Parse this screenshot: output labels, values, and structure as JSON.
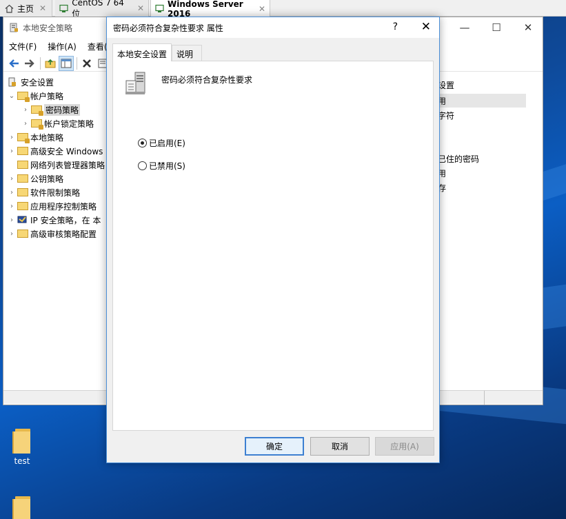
{
  "vm_tabs": [
    {
      "label": "主页",
      "icon": "home-icon"
    },
    {
      "label": "CentOS 7 64 位",
      "icon": "vm-icon"
    },
    {
      "label": "Windows Server 2016",
      "icon": "vm-icon",
      "active": true
    }
  ],
  "mmc": {
    "title": "本地安全策略",
    "menu": [
      "文件(F)",
      "操作(A)",
      "查看(V)"
    ],
    "tree": [
      {
        "label": "安全设置",
        "level": 0
      },
      {
        "label": "帐户策略",
        "level": 1
      },
      {
        "label": "密码策略",
        "level": 2,
        "selected": true
      },
      {
        "label": "帐户锁定策略",
        "level": 2
      },
      {
        "label": "本地策略",
        "level": 1
      },
      {
        "label": "高级安全 Windows",
        "level": 1
      },
      {
        "label": "网络列表管理器策略",
        "level": 1
      },
      {
        "label": "公钥策略",
        "level": 1
      },
      {
        "label": "软件限制策略",
        "level": 1
      },
      {
        "label": "应用程序控制策略",
        "level": 1
      },
      {
        "label": "IP 安全策略，在 本",
        "level": 1
      },
      {
        "label": "高级审核策略配置",
        "level": 1
      }
    ],
    "right_items": [
      "设置",
      "用",
      "字符",
      "已住的密码",
      "用",
      "存"
    ]
  },
  "dialog": {
    "title": "密码必须符合复杂性要求 属性",
    "help": "?",
    "close": "✕",
    "tabs": [
      "本地安全设置",
      "说明"
    ],
    "policy_name": "密码必须符合复杂性要求",
    "options": [
      {
        "label": "已启用(E)",
        "checked": true
      },
      {
        "label": "已禁用(S)",
        "checked": false
      }
    ],
    "buttons": {
      "ok": "确定",
      "cancel": "取消",
      "apply": "应用(A)"
    }
  },
  "desktop": {
    "icons": [
      {
        "label": "test"
      },
      {
        "label": ""
      }
    ]
  }
}
